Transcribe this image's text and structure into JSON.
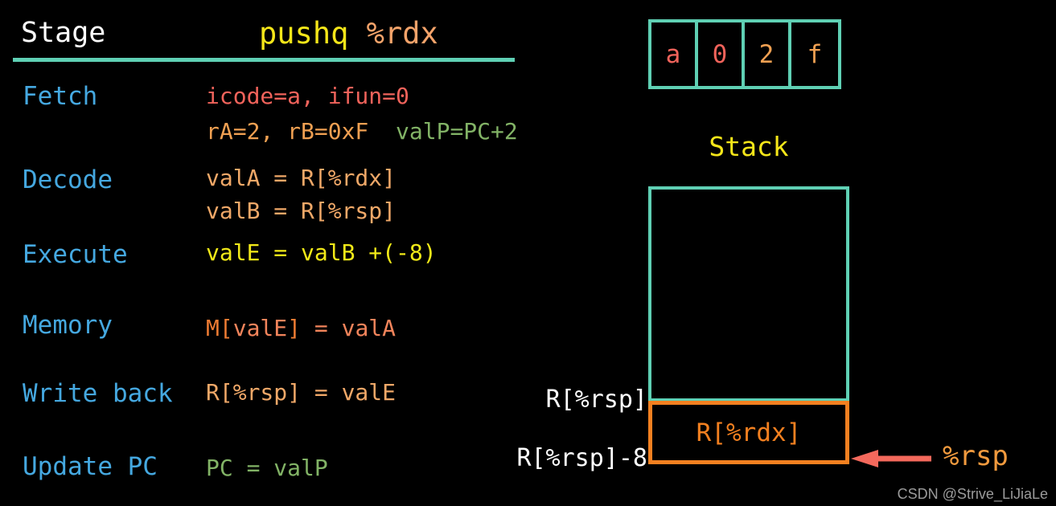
{
  "header": {
    "stage_column_label": "Stage",
    "instruction_mnemonic": "pushq",
    "instruction_operand": "%rdx"
  },
  "stages": [
    {
      "name": "Fetch",
      "line1": "icode=a, ifun=0",
      "line2_part1": "rA=2, rB=0xF",
      "line2_part2": "valP=PC+2"
    },
    {
      "name": "Decode",
      "line1": "valA = R[%rdx]",
      "line2": "valB = R[%rsp]"
    },
    {
      "name": "Execute",
      "line1": "valE = valB +(-8)"
    },
    {
      "name": "Memory",
      "line1_bracket_open": "M[",
      "line1_val1": "valE",
      "line1_bracket_close": "]",
      "line1_eq": " = ",
      "line1_val2": "valA"
    },
    {
      "name": "Write back",
      "line1": "R[%rsp] = valE"
    },
    {
      "name": "Update PC",
      "line1": "PC = valP"
    }
  ],
  "instruction_bytes": [
    {
      "value": "a",
      "color": "#F1635B"
    },
    {
      "value": "0",
      "color": "#F1635B"
    },
    {
      "value": "2",
      "color": "#F0A052"
    },
    {
      "value": "f",
      "color": "#F0A052"
    }
  ],
  "stack_diagram": {
    "title": "Stack",
    "top_address_label": "R[%rsp]",
    "bottom_address_label": "R[%rsp]-8",
    "pushed_value": "R[%rdx]",
    "pointer_label": "%rsp"
  },
  "colors": {
    "background": "#000000",
    "accent_teal": "#5FD0B4",
    "stage_blue": "#45A8E0",
    "yellow": "#F5E619",
    "orange": "#F38020",
    "peach": "#F0A868",
    "salmon": "#F1635B",
    "green": "#82B366",
    "arrow_red": "#F4695C",
    "white": "#FFFFFF"
  },
  "watermark": "CSDN @Strive_LiJiaLe"
}
